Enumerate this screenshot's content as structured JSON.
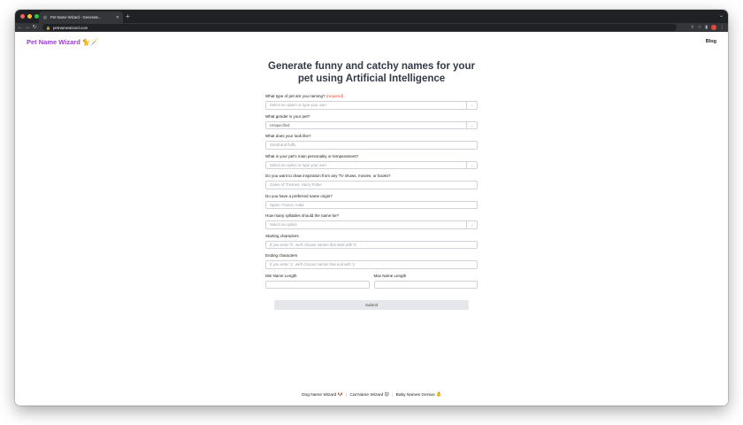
{
  "browser": {
    "tab_title": "Pet Name Wizard - Generate...",
    "url": "petnamewizard.com",
    "colors": {
      "red": "#ff5f57",
      "yellow": "#febc2e",
      "green": "#28c840"
    }
  },
  "header": {
    "logo": "Pet Name Wizard 🐈🪄",
    "blog_link": "Blog"
  },
  "headline": "Generate funny and catchy names for your pet using Artificial Intelligence",
  "form": {
    "pet_type": {
      "label": "What type of pet are you naming?",
      "required": "(required)",
      "placeholder": "Select an option or type your own"
    },
    "gender": {
      "label": "What gender is your pet?",
      "value": "Unspecified"
    },
    "look": {
      "label": "What does your look like?",
      "placeholder": "Small and fluffy"
    },
    "personality": {
      "label": "What is your pet's main personality or temperament?",
      "placeholder": "Select an option or type your own"
    },
    "inspiration": {
      "label": "Do you want to draw inspiration from any TV shows, movies, or books?",
      "placeholder": "Game of Thrones, Harry Potter"
    },
    "origin": {
      "label": "Do you have a preferred name origin?",
      "placeholder": "Spain, France, India"
    },
    "syllables": {
      "label": "How many syllables should the name be?",
      "placeholder": "Select an option"
    },
    "starting": {
      "label": "Starting characters",
      "placeholder": "If you enter 'b', we'll choose names that start with 'b'"
    },
    "ending": {
      "label": "Ending characters",
      "placeholder": "If you enter 'y', we'll choose names that end with 'y'"
    },
    "min_length": {
      "label": "Min Name Length"
    },
    "max_length": {
      "label": "Max Name Length"
    },
    "submit": "Submit"
  },
  "footer": {
    "links": [
      "Dog Name Wizard 🐶",
      "Cat Name Wizard 🐱",
      "Baby Names Genius 👶"
    ],
    "separator": "|"
  }
}
